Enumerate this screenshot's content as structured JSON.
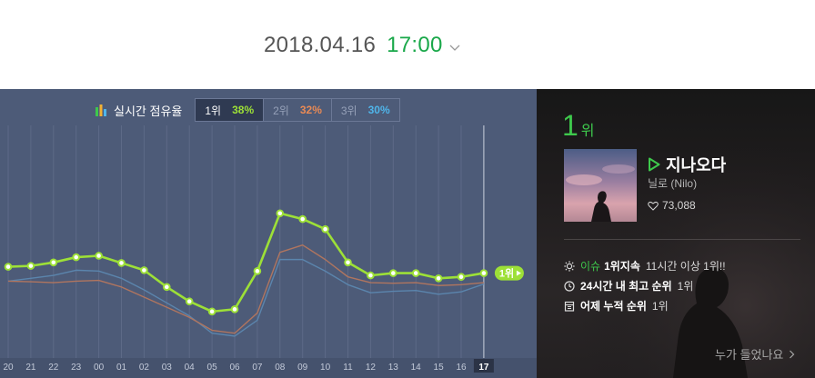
{
  "header": {
    "date": "2018.04.16",
    "time": "17:00"
  },
  "legend": {
    "title": "실시간 점유율",
    "tabs": [
      {
        "rank": "1위",
        "pct": "38%",
        "color": "#9de037"
      },
      {
        "rank": "2위",
        "pct": "32%",
        "color": "#e98a55"
      },
      {
        "rank": "3위",
        "pct": "30%",
        "color": "#4fb5ea"
      }
    ]
  },
  "chart_data": {
    "type": "line",
    "x": [
      "20",
      "21",
      "22",
      "23",
      "00",
      "01",
      "02",
      "03",
      "04",
      "05",
      "06",
      "07",
      "08",
      "09",
      "10",
      "11",
      "12",
      "13",
      "14",
      "15",
      "16",
      "17"
    ],
    "y_axis_visible": false,
    "highlight_x": "17",
    "end_label": "1위",
    "series": [
      {
        "name": "1위",
        "color": "#9de037",
        "markers": true,
        "values": [
          38.5,
          38.8,
          40.0,
          41.8,
          42.3,
          39.8,
          37.3,
          31.5,
          26.5,
          23.0,
          23.8,
          37.0,
          57.0,
          55.0,
          51.5,
          40.0,
          35.5,
          36.3,
          36.3,
          34.5,
          35.0,
          36.3
        ]
      },
      {
        "name": "2위",
        "color": "#b0755f",
        "markers": false,
        "values": [
          33.5,
          33.3,
          33.0,
          33.5,
          33.8,
          31.5,
          28.0,
          24.5,
          21.0,
          16.5,
          15.5,
          22.5,
          43.5,
          46.0,
          41.0,
          35.0,
          33.0,
          32.8,
          33.0,
          32.0,
          32.3,
          33.0
        ]
      },
      {
        "name": "3위",
        "color": "#5b85ad",
        "markers": false,
        "values": [
          33.5,
          34.5,
          35.5,
          37.3,
          37.0,
          34.5,
          30.5,
          26.0,
          21.5,
          15.5,
          14.5,
          20.0,
          41.0,
          41.0,
          37.0,
          32.3,
          29.5,
          30.0,
          30.3,
          29.0,
          29.8,
          32.5
        ]
      }
    ]
  },
  "song": {
    "rank": "1",
    "rank_unit": "위",
    "title": "지나오다",
    "artist": "닐로 (Nilo)",
    "likes": "73,088"
  },
  "info": {
    "row1_tag": "이슈",
    "row1_strong": "1위지속",
    "row1_text": "11시간 이상 1위!!",
    "row2_strong": "24시간 내 최고 순위",
    "row2_text": "1위",
    "row3_strong": "어제 누적 순위",
    "row3_text": "1위"
  },
  "who_listened": "누가 들었나요",
  "icons": {
    "time_dropdown": "chevron-down-icon",
    "legend": "bar-chart-icon",
    "play": "play-icon",
    "likes": "heart-icon",
    "issue": "sun-icon",
    "peak": "clock-icon",
    "cumulative": "calendar-icon",
    "who": "chevron-right-icon"
  }
}
